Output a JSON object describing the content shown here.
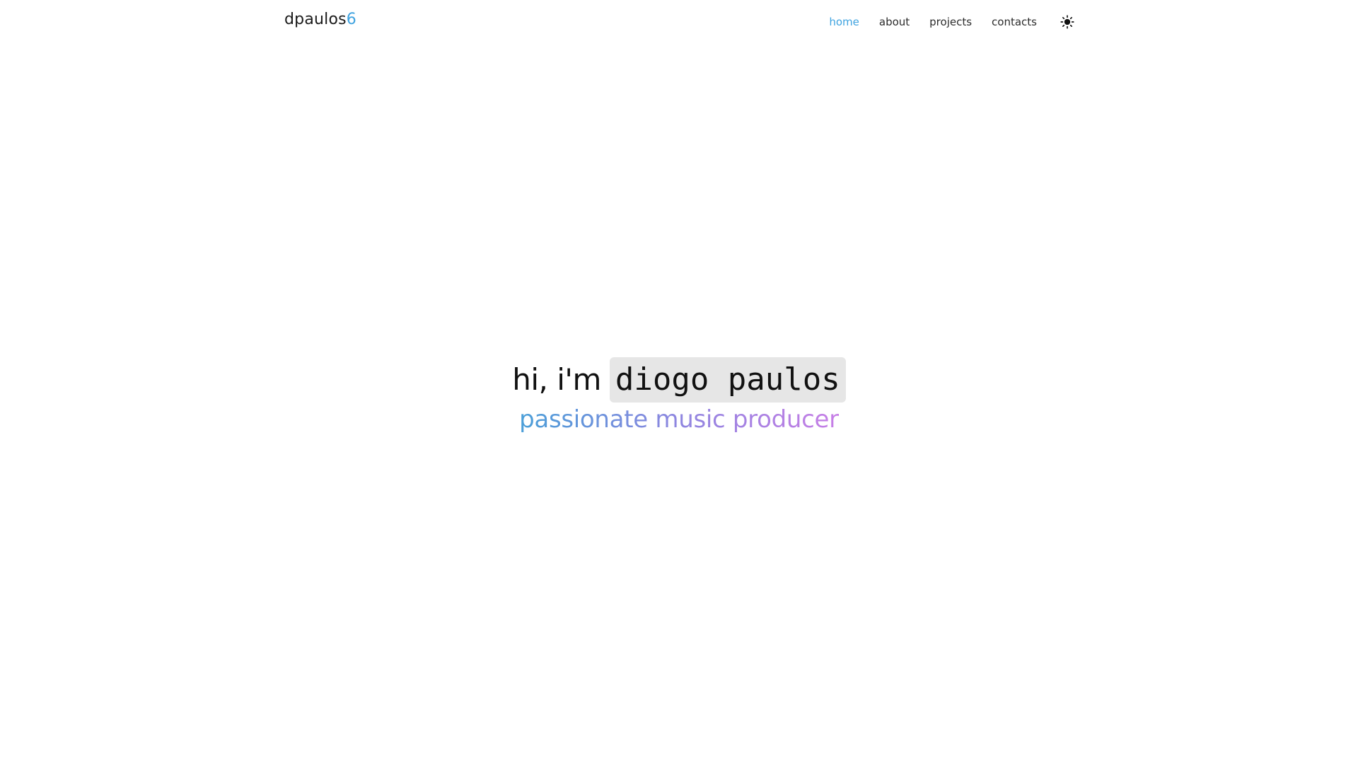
{
  "header": {
    "logo": {
      "text": "dpaulos",
      "accent": "6"
    },
    "nav": [
      {
        "label": "home",
        "active": true
      },
      {
        "label": "about",
        "active": false
      },
      {
        "label": "projects",
        "active": false
      },
      {
        "label": "contacts",
        "active": false
      }
    ],
    "theme_toggle_icon": "sun-icon"
  },
  "hero": {
    "greeting": "hi, i'm",
    "name": "diogo paulos",
    "tagline": "passionate music producer"
  },
  "colors": {
    "accent": "#3fa3e0",
    "gradient_start": "#4a9fd8",
    "gradient_mid": "#8f86e0",
    "gradient_end": "#c77ee6",
    "name_highlight": "#e6e6e6",
    "text": "#111111"
  }
}
